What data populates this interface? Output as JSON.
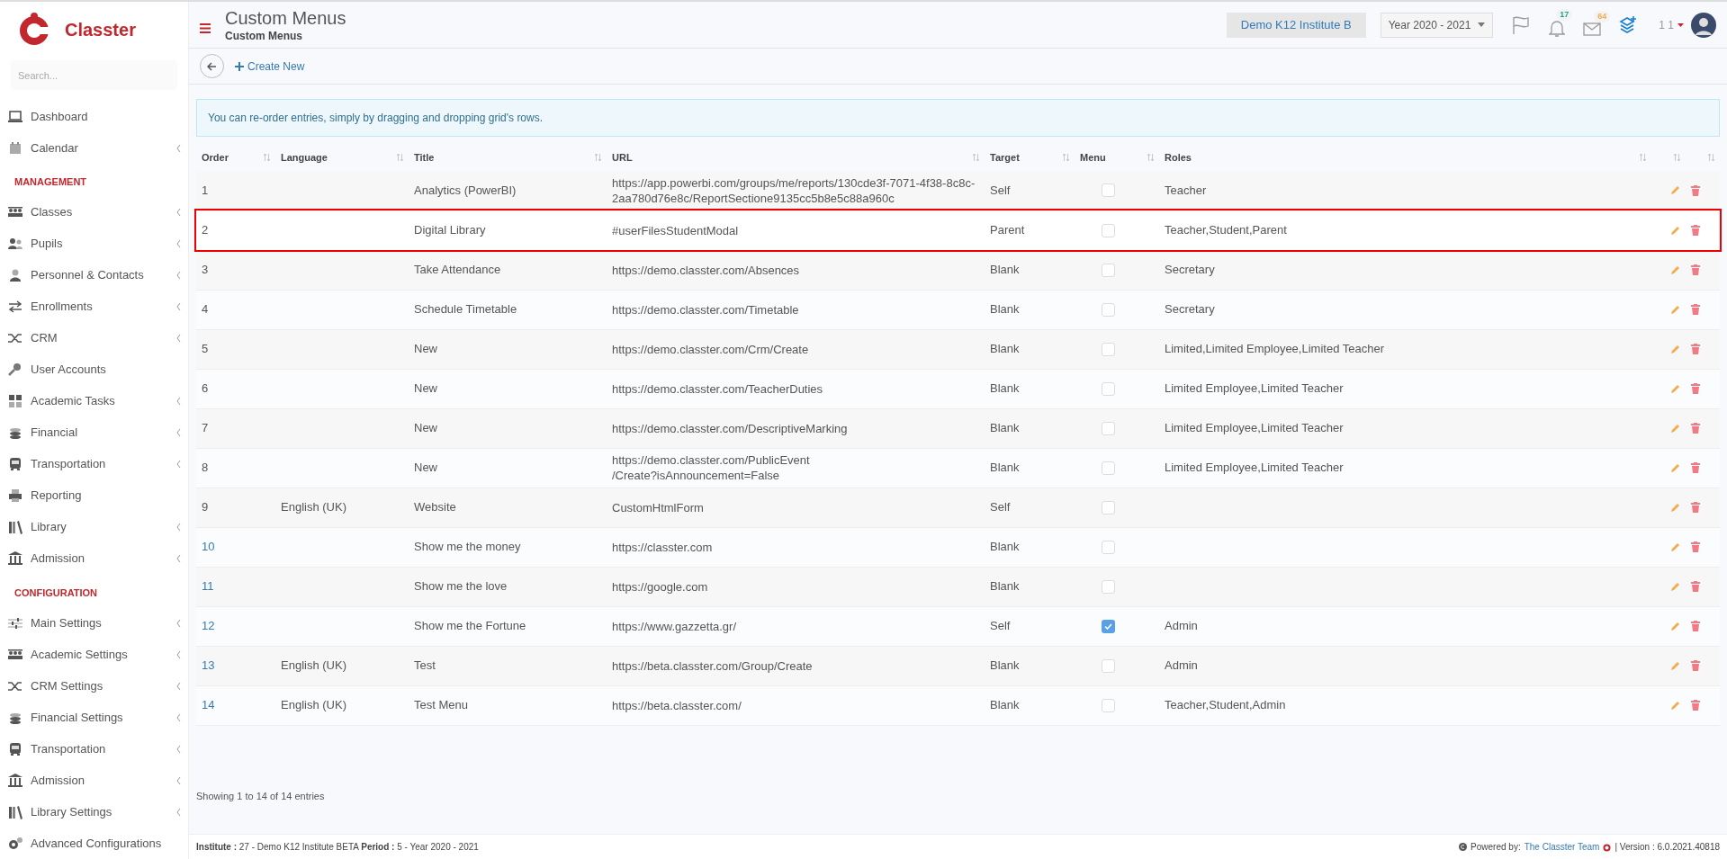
{
  "brand": {
    "name": "Classter"
  },
  "sidebar": {
    "search": {
      "placeholder": "Search..."
    },
    "sections": [
      {
        "items": [
          {
            "label": "Dashboard",
            "expandable": false
          },
          {
            "label": "Calendar",
            "expandable": true
          }
        ]
      },
      {
        "heading": "MANAGEMENT",
        "items": [
          {
            "label": "Classes",
            "expandable": true
          },
          {
            "label": "Pupils",
            "expandable": true
          },
          {
            "label": "Personnel & Contacts",
            "expandable": true
          },
          {
            "label": "Enrollments",
            "expandable": true
          },
          {
            "label": "CRM",
            "expandable": true
          },
          {
            "label": "User Accounts",
            "expandable": false
          },
          {
            "label": "Academic Tasks",
            "expandable": true
          },
          {
            "label": "Financial",
            "expandable": true
          },
          {
            "label": "Transportation",
            "expandable": true
          },
          {
            "label": "Reporting",
            "expandable": false
          },
          {
            "label": "Library",
            "expandable": true
          },
          {
            "label": "Admission",
            "expandable": true
          }
        ]
      },
      {
        "heading": "CONFIGURATION",
        "items": [
          {
            "label": "Main Settings",
            "expandable": true
          },
          {
            "label": "Academic Settings",
            "expandable": true
          },
          {
            "label": "CRM Settings",
            "expandable": true
          },
          {
            "label": "Financial Settings",
            "expandable": true
          },
          {
            "label": "Transportation",
            "expandable": true
          },
          {
            "label": "Admission",
            "expandable": true
          },
          {
            "label": "Library Settings",
            "expandable": true
          },
          {
            "label": "Advanced Configurations",
            "expandable": false
          }
        ]
      }
    ]
  },
  "header": {
    "title": "Custom Menus",
    "breadcrumb": "Custom Menus",
    "institute": "Demo K12 Institute B",
    "year": "Year 2020 - 2021",
    "notifications": "17",
    "messages": "64",
    "user": "1 1"
  },
  "toolbar": {
    "create": "Create New"
  },
  "alert": "You can re-order entries, simply by dragging and dropping grid's rows.",
  "table": {
    "columns": [
      "Order",
      "Language",
      "Title",
      "URL",
      "Target",
      "Menu",
      "Roles"
    ],
    "rows": [
      {
        "order": "1",
        "link": false,
        "language": "",
        "title": "Analytics (PowerBI)",
        "url": "https://app.powerbi.com/groups/me/reports/130cde3f-7071-4f38-8c8c-2aa780d76e8c/ReportSectione9135cc5b8e5c88a960c",
        "target": "Self",
        "menu": false,
        "roles": "Teacher",
        "highlighted": false
      },
      {
        "order": "2",
        "link": false,
        "language": "",
        "title": "Digital Library",
        "url": "#userFilesStudentModal",
        "target": "Parent",
        "menu": false,
        "roles": "Teacher,Student,Parent",
        "highlighted": true
      },
      {
        "order": "3",
        "link": false,
        "language": "",
        "title": "Take Attendance",
        "url": "https://demo.classter.com/Absences",
        "target": "Blank",
        "menu": false,
        "roles": "Secretary",
        "highlighted": false
      },
      {
        "order": "4",
        "link": false,
        "language": "",
        "title": "Schedule Timetable",
        "url": "https://demo.classter.com/Timetable",
        "target": "Blank",
        "menu": false,
        "roles": "Secretary",
        "highlighted": false
      },
      {
        "order": "5",
        "link": false,
        "language": "",
        "title": "New",
        "url": "https://demo.classter.com/Crm/Create",
        "target": "Blank",
        "menu": false,
        "roles": "Limited,Limited Employee,Limited Teacher",
        "highlighted": false
      },
      {
        "order": "6",
        "link": false,
        "language": "",
        "title": "New",
        "url": "https://demo.classter.com/TeacherDuties",
        "target": "Blank",
        "menu": false,
        "roles": "Limited Employee,Limited Teacher",
        "highlighted": false
      },
      {
        "order": "7",
        "link": false,
        "language": "",
        "title": "New",
        "url": "https://demo.classter.com/DescriptiveMarking",
        "target": "Blank",
        "menu": false,
        "roles": "Limited Employee,Limited Teacher",
        "highlighted": false
      },
      {
        "order": "8",
        "link": false,
        "language": "",
        "title": "New",
        "url": "https://demo.classter.com/PublicEvent\n/Create?isAnnouncement=False",
        "target": "Blank",
        "menu": false,
        "roles": "Limited Employee,Limited Teacher",
        "highlighted": false
      },
      {
        "order": "9",
        "link": false,
        "language": "English (UK)",
        "title": "Website",
        "url": "CustomHtmlForm",
        "target": "Self",
        "menu": false,
        "roles": "",
        "highlighted": false
      },
      {
        "order": "10",
        "link": true,
        "language": "",
        "title": "Show me the money",
        "url": "https://classter.com",
        "target": "Blank",
        "menu": false,
        "roles": "",
        "highlighted": false
      },
      {
        "order": "11",
        "link": true,
        "language": "",
        "title": "Show me the love",
        "url": "https://google.com",
        "target": "Blank",
        "menu": false,
        "roles": "",
        "highlighted": false
      },
      {
        "order": "12",
        "link": true,
        "language": "",
        "title": "Show me the Fortune",
        "url": "https://www.gazzetta.gr/",
        "target": "Self",
        "menu": true,
        "roles": "Admin",
        "highlighted": false
      },
      {
        "order": "13",
        "link": true,
        "language": "English (UK)",
        "title": "Test",
        "url": "https://beta.classter.com/Group/Create",
        "target": "Blank",
        "menu": false,
        "roles": "Admin",
        "highlighted": false
      },
      {
        "order": "14",
        "link": true,
        "language": "English (UK)",
        "title": "Test Menu",
        "url": "https://beta.classter.com/",
        "target": "Blank",
        "menu": false,
        "roles": "Teacher,Student,Admin",
        "highlighted": false
      }
    ],
    "info": "Showing 1 to 14 of 14 entries"
  },
  "footer": {
    "left": "**Institute :** 27 - Demo K12 Institute BETA **Period :** 5 - Year 2020 - 2021",
    "powered_by": "Powered by:",
    "team_link": "The Classter Team",
    "version": "| Version : 6.0.2021.40818"
  }
}
